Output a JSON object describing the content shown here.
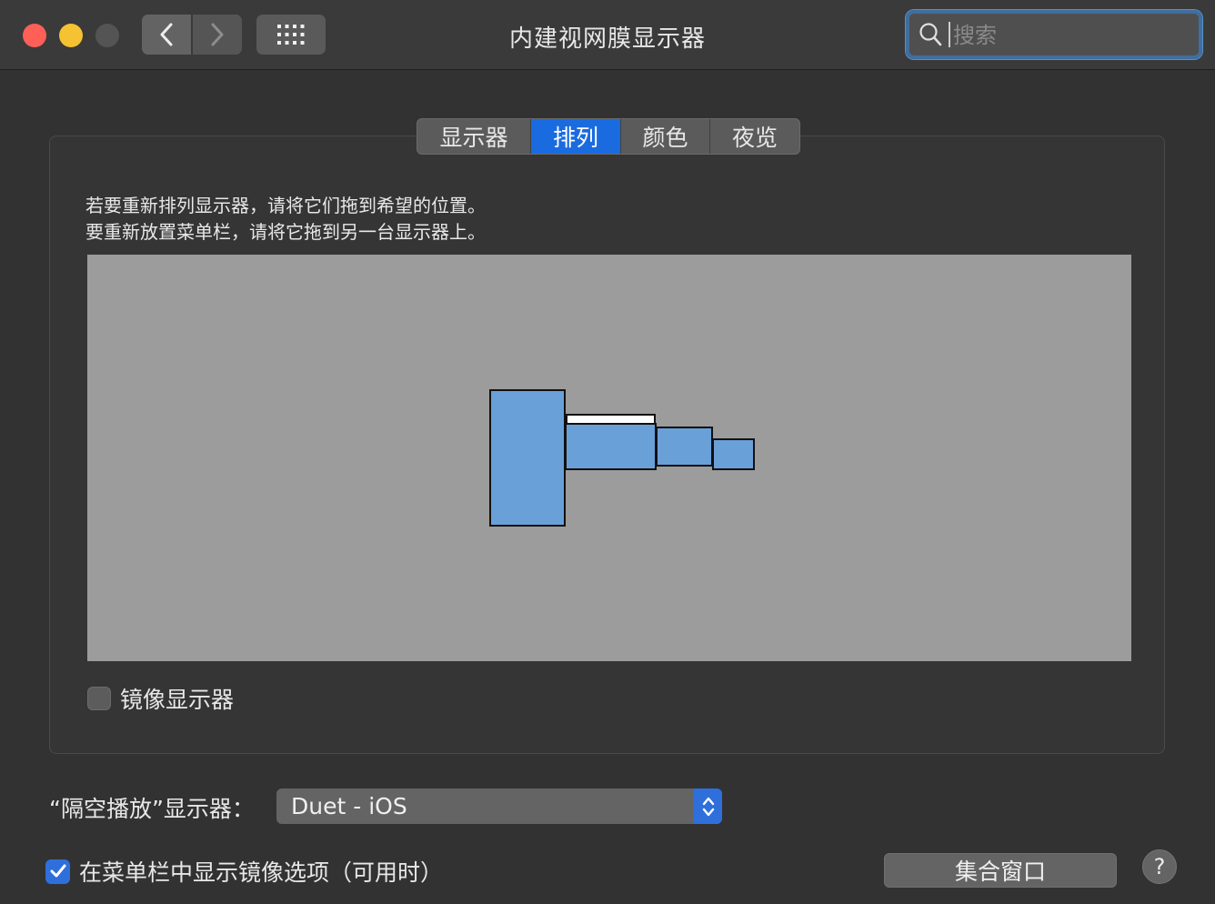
{
  "window": {
    "title": "内建视网膜显示器",
    "search_placeholder": "搜索"
  },
  "tabs": [
    {
      "label": "显示器",
      "active": false
    },
    {
      "label": "排列",
      "active": true
    },
    {
      "label": "颜色",
      "active": false
    },
    {
      "label": "夜览",
      "active": false
    }
  ],
  "arrangement": {
    "instruction_line1": "若要重新排列显示器，请将它们拖到希望的位置。",
    "instruction_line2": "要重新放置菜单栏，请将它拖到另一台显示器上。",
    "display_count": 4,
    "display_color": "#6aa0d8"
  },
  "mirror": {
    "label": "镜像显示器",
    "checked": false
  },
  "airplay": {
    "label": "“隔空播放”显示器：",
    "selected": "Duet - iOS"
  },
  "menu_option": {
    "label": "在菜单栏中显示镜像选项（可用时）",
    "checked": true
  },
  "buttons": {
    "gather": "集合窗口",
    "help": "?"
  },
  "colors": {
    "accent": "#1a6be0",
    "close": "#fe5f57",
    "minimize": "#f5c231"
  }
}
